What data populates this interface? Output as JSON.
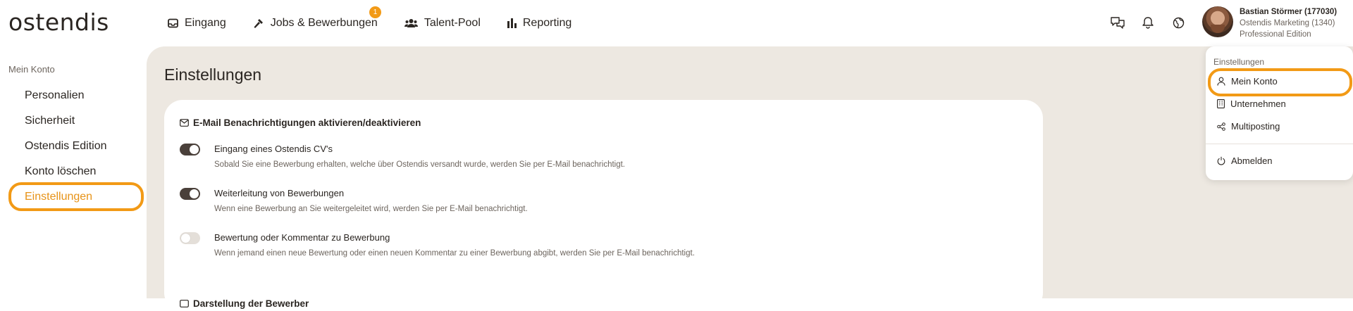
{
  "app": {
    "logo": "ostendis"
  },
  "nav": {
    "items": [
      {
        "label": "Eingang",
        "icon": "inbox-icon"
      },
      {
        "label": "Jobs & Bewerbungen",
        "icon": "hammer-icon"
      },
      {
        "label": "Talent-Pool",
        "icon": "users-icon"
      },
      {
        "label": "Reporting",
        "icon": "bar-chart-icon"
      }
    ],
    "jobs_badge": "1"
  },
  "user": {
    "name": "Bastian Störmer (177030)",
    "company": "Ostendis Marketing (1340)",
    "edition": "Professional Edition"
  },
  "sidebar": {
    "heading": "Mein Konto",
    "items": [
      {
        "label": "Personalien"
      },
      {
        "label": "Sicherheit"
      },
      {
        "label": "Ostendis Edition"
      },
      {
        "label": "Konto löschen"
      },
      {
        "label": "Einstellungen"
      }
    ],
    "active_index": 4
  },
  "main": {
    "title": "Einstellungen",
    "section_title": "E-Mail Benachrichtigungen aktivieren/deaktivieren",
    "settings": [
      {
        "label": "Eingang eines Ostendis CV's",
        "description": "Sobald Sie eine Bewerbung erhalten, welche über Ostendis versandt wurde, werden Sie per E-Mail benachrichtigt.",
        "enabled": true
      },
      {
        "label": "Weiterleitung von Bewerbungen",
        "description": "Wenn eine Bewerbung an Sie weitergeleitet wird, werden Sie per E-Mail benachrichtigt.",
        "enabled": true
      },
      {
        "label": "Bewertung oder Kommentar zu Bewerbung",
        "description": "Wenn jemand einen neue Bewertung oder einen neuen Kommentar zu einer Bewerbung abgibt, werden Sie per E-Mail benachrichtigt.",
        "enabled": false
      }
    ],
    "section2_title": "Darstellung der Bewerber"
  },
  "dropdown": {
    "heading": "Einstellungen",
    "items": [
      {
        "label": "Mein Konto",
        "icon": "user-icon"
      },
      {
        "label": "Unternehmen",
        "icon": "building-icon"
      },
      {
        "label": "Multiposting",
        "icon": "share-icon"
      }
    ],
    "logout": "Abmelden"
  },
  "colors": {
    "accent": "#f29a16",
    "active_text": "#e79318",
    "toggle_on": "#4a403a",
    "toggle_off": "#e4dfd9",
    "main_bg": "#ede8e1"
  }
}
